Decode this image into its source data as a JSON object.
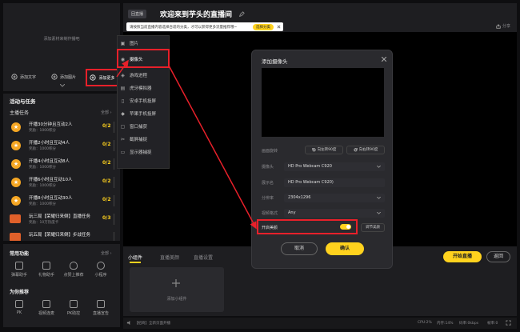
{
  "header": {
    "badge": "回直播",
    "title": "欢迎来到芋头的直播间",
    "edit_icon": "edit-icon",
    "share_label": "分享"
  },
  "notice": {
    "text": "请按照当前直播内容选择合适的分类，才可以获得更多流量推荐哦~",
    "button": "选择分类"
  },
  "scene": {
    "empty_hint": "添加素材来制作播吧",
    "add_text": "添加文字",
    "add_image": "添加图片",
    "add_more": "添加更多"
  },
  "add_menu": {
    "items": [
      {
        "label": "图片",
        "icon": "image-icon"
      },
      {
        "label": "摄像头",
        "icon": "camera-icon"
      },
      {
        "label": "游戏进程",
        "icon": "game-icon"
      },
      {
        "label": "虎牙模拟器",
        "icon": "emulator-icon"
      },
      {
        "label": "安卓手机投屏",
        "icon": "android-icon"
      },
      {
        "label": "苹果手机投屏",
        "icon": "apple-icon"
      },
      {
        "label": "窗口捕获",
        "icon": "window-icon"
      },
      {
        "label": "截屏捕捉",
        "icon": "screenshot-icon"
      },
      {
        "label": "显示器捕捉",
        "icon": "monitor-icon"
      }
    ]
  },
  "activities": {
    "title": "活动与任务",
    "section": "主播任务",
    "all": "全部",
    "tasks": [
      {
        "name": "开播30分钟且互动2人",
        "reward": "奖励：1000积分",
        "progress": "0/2"
      },
      {
        "name": "开播2小时且互动4人",
        "reward": "奖励：1000积分",
        "progress": "0/2"
      },
      {
        "name": "开播4小时且互动8人",
        "reward": "奖励：1000积分",
        "progress": "0/2"
      },
      {
        "name": "开播6小时且互动10人",
        "reward": "奖励：1000积分",
        "progress": "0/2"
      },
      {
        "name": "开播8小时且互动30人",
        "reward": "奖励：1000积分",
        "progress": "0/2"
      },
      {
        "name": "玩三局【荣耀归来倒】直播任务",
        "reward": "奖励：10万热度卡",
        "progress": "0/3"
      },
      {
        "name": "玩五局【荣耀归来倒】步战任务",
        "reward": "",
        "progress": ""
      }
    ]
  },
  "common": {
    "title": "常用功能",
    "all": "全部",
    "tools": [
      {
        "label": "弹幕助手"
      },
      {
        "label": "礼物助手"
      },
      {
        "label": "点赞上推荐"
      },
      {
        "label": "小程序"
      }
    ],
    "recommend_title": "为你推荐",
    "recommend": [
      {
        "label": "PK"
      },
      {
        "label": "视频连麦"
      },
      {
        "label": "PK助控"
      },
      {
        "label": "直播宣告"
      }
    ]
  },
  "bottom_tabs": {
    "tabs": [
      "小组件",
      "直播美颜",
      "直播设置"
    ],
    "add_widget": "添加小组件"
  },
  "start": {
    "start_label": "开始直播",
    "return_label": "返回"
  },
  "status": {
    "notice": "【招商】全新页面开播",
    "cpu": "CPU:2%",
    "memory": "内存:14%",
    "bitrate": "码率:0kbps",
    "fps": "帧率:0"
  },
  "dialog": {
    "title": "添加摄像头",
    "rotate_label": "画面旋转",
    "rotate_left": "向左转90度",
    "rotate_right": "向右转90度",
    "camera_label": "摄像头",
    "camera_value": "HD Pro Webcam C920",
    "name_label": "展示名",
    "name_value": "HD Pro Webcam C920)",
    "resolution_label": "分辨率",
    "resolution_value": "2304x1296",
    "format_label": "视频格式",
    "format_value": "Any",
    "beauty_label": "开启美颜",
    "beauty_on": true,
    "beauty_button": "调节美颜",
    "cancel": "取消",
    "confirm": "确认"
  },
  "colors": {
    "accent": "#ffd21e",
    "highlight": "#e8202a",
    "panel": "#1e1e21"
  }
}
